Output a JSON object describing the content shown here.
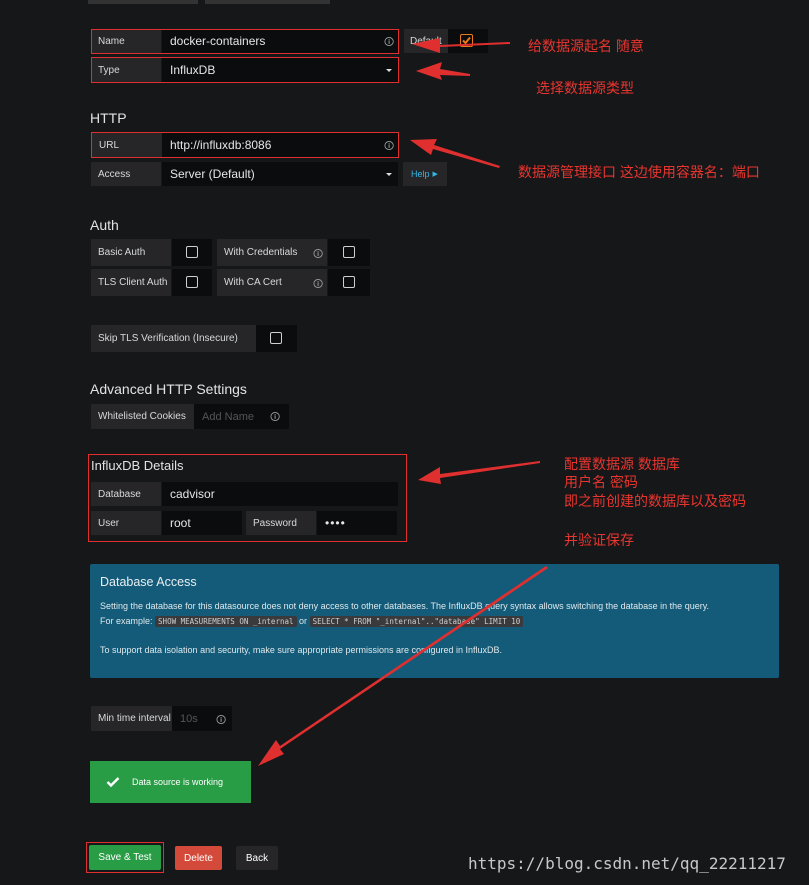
{
  "form": {
    "name_label": "Name",
    "name_value": "docker-containers",
    "default_label": "Default",
    "type_label": "Type",
    "type_value": "InfluxDB"
  },
  "http": {
    "heading": "HTTP",
    "url_label": "URL",
    "url_value": "http://influxdb:8086",
    "access_label": "Access",
    "access_value": "Server (Default)",
    "help_label": "Help"
  },
  "auth": {
    "heading": "Auth",
    "basic_auth": "Basic Auth",
    "with_credentials": "With Credentials",
    "tls_client_auth": "TLS Client Auth",
    "with_ca_cert": "With CA Cert",
    "skip_tls": "Skip TLS Verification (Insecure)"
  },
  "advanced": {
    "heading": "Advanced HTTP Settings",
    "cookies_label": "Whitelisted Cookies",
    "cookies_placeholder": "Add Name"
  },
  "influx": {
    "heading": "InfluxDB Details",
    "database_label": "Database",
    "database_value": "cadvisor",
    "user_label": "User",
    "user_value": "root",
    "password_label": "Password",
    "password_value": "••••"
  },
  "access_box": {
    "title": "Database Access",
    "line1": "Setting the database for this datasource does not deny access to other databases. The InfluxDB query syntax allows switching the database in the query.",
    "example_prefix": "For example:",
    "code1": "SHOW MEASUREMENTS ON _internal",
    "or": "or",
    "code2": "SELECT * FROM \"_internal\"..\"database\" LIMIT 10",
    "line2": "To support data isolation and security, make sure appropriate permissions are configured in InfluxDB."
  },
  "interval": {
    "label": "Min time interval",
    "placeholder": "10s"
  },
  "status": {
    "message": "Data source is working"
  },
  "buttons": {
    "save": "Save & Test",
    "delete": "Delete",
    "back": "Back"
  },
  "annotations": {
    "name_note": "给数据源起名  随意",
    "type_note": "选择数据源类型",
    "url_note": "数据源管理接口  这边使用容器名：端口",
    "db_note1": "配置数据源  数据库",
    "db_note2": "用户名  密码",
    "db_note3": "即之前创建的数据库以及密码",
    "db_note4": "并验证保存"
  },
  "watermark": "https://blog.csdn.net/qq_22211217",
  "colors": {
    "background": "#161719",
    "accent_orange": "#eb7b18",
    "success_green": "#299c46",
    "delete_red": "#d44a3a",
    "info_blue": "#135b78",
    "annotation_red": "#e02f2f"
  }
}
